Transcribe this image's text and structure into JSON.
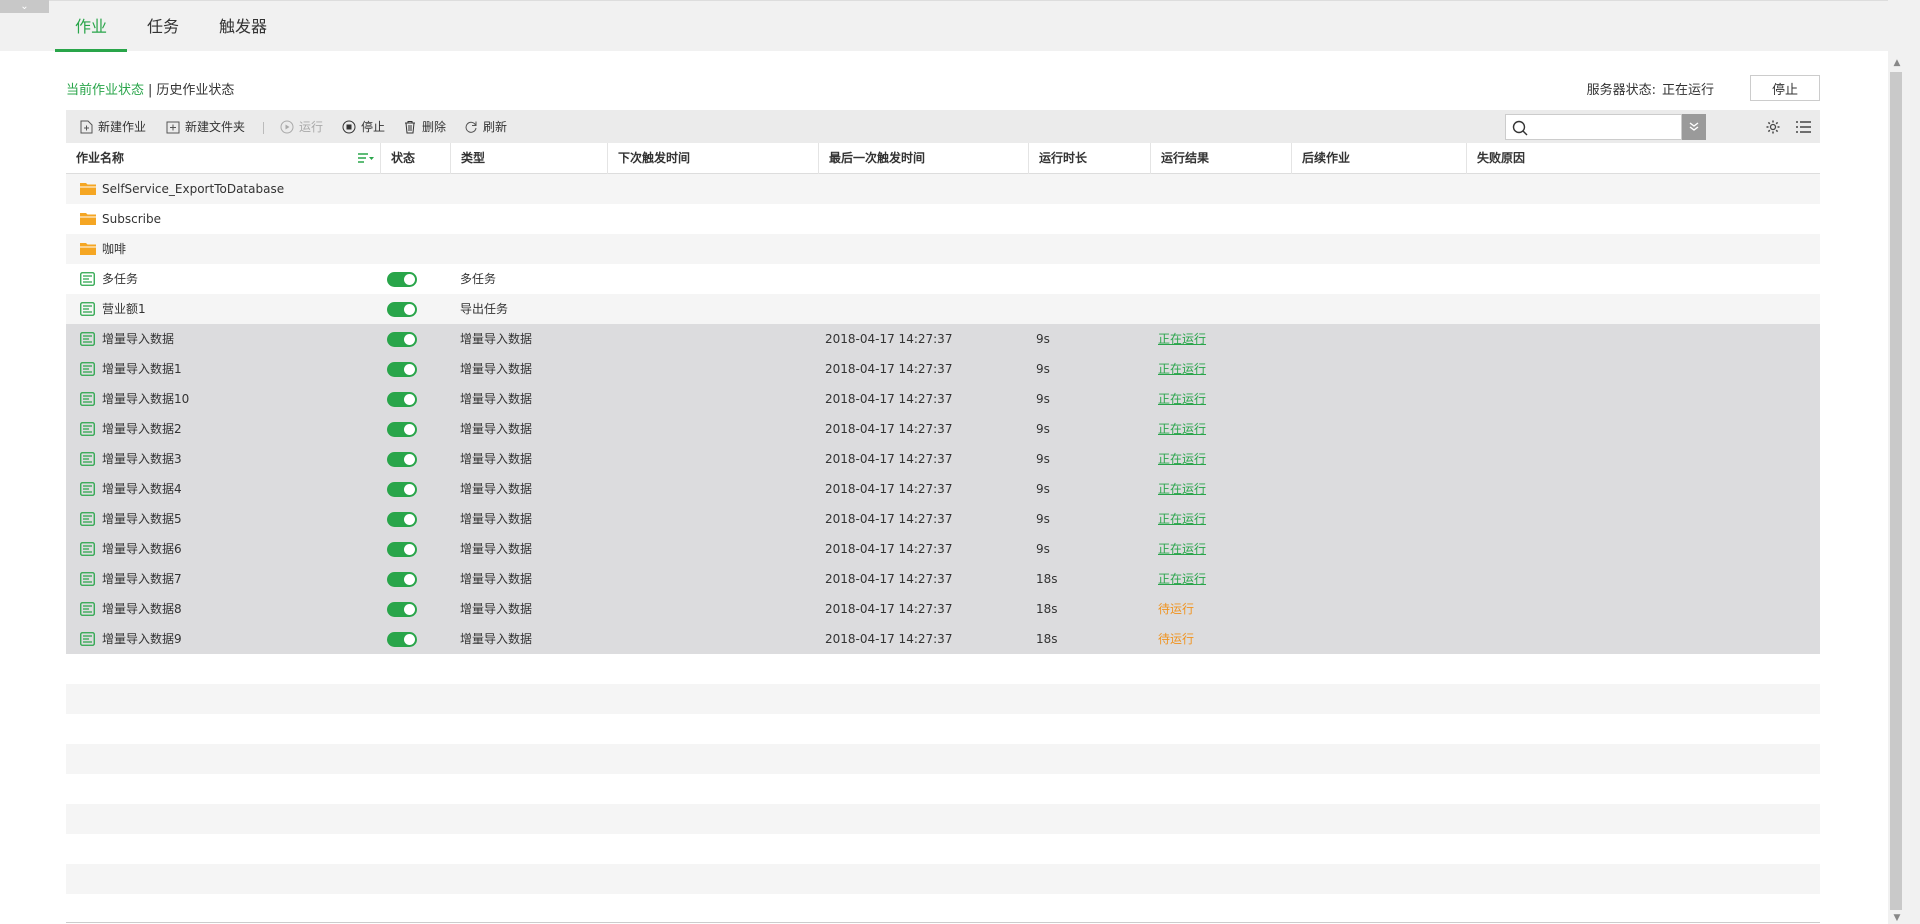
{
  "collapse_glyph": "⌄",
  "tabs": [
    {
      "label": "作业",
      "active": true
    },
    {
      "label": "任务",
      "active": false
    },
    {
      "label": "触发器",
      "active": false
    }
  ],
  "status_tabs": {
    "current": "当前作业状态",
    "separator": "|",
    "history": "历史作业状态"
  },
  "server_status": {
    "label": "服务器状态:",
    "value": "正在运行",
    "stop_button": "停止"
  },
  "toolbar": {
    "new_job": "新建作业",
    "new_folder": "新建文件夹",
    "run": "运行",
    "stop": "停止",
    "delete": "删除",
    "refresh": "刷新",
    "search_placeholder": ""
  },
  "columns": [
    "作业名称",
    "状态",
    "类型",
    "下次触发时间",
    "最后一次触发时间",
    "运行时长",
    "运行结果",
    "后续作业",
    "失败原因"
  ],
  "rows": [
    {
      "kind": "folder",
      "name": "SelfService_ExportToDatabase",
      "toggle": false,
      "type": "",
      "last": "",
      "duration": "",
      "result": "",
      "result_kind": "",
      "selected": false
    },
    {
      "kind": "folder",
      "name": "Subscribe",
      "toggle": false,
      "type": "",
      "last": "",
      "duration": "",
      "result": "",
      "result_kind": "",
      "selected": false
    },
    {
      "kind": "folder",
      "name": "咖啡",
      "toggle": false,
      "type": "",
      "last": "",
      "duration": "",
      "result": "",
      "result_kind": "",
      "selected": false
    },
    {
      "kind": "job",
      "name": "多任务",
      "toggle": true,
      "type": "多任务",
      "last": "",
      "duration": "",
      "result": "",
      "result_kind": "",
      "selected": false
    },
    {
      "kind": "job",
      "name": "营业额1",
      "toggle": true,
      "type": "导出任务",
      "last": "",
      "duration": "",
      "result": "",
      "result_kind": "",
      "selected": false
    },
    {
      "kind": "job",
      "name": "增量导入数据",
      "toggle": true,
      "type": "增量导入数据",
      "last": "2018-04-17 14:27:37",
      "duration": "9s",
      "result": "正在运行",
      "result_kind": "running",
      "selected": true
    },
    {
      "kind": "job",
      "name": "增量导入数据1",
      "toggle": true,
      "type": "增量导入数据",
      "last": "2018-04-17 14:27:37",
      "duration": "9s",
      "result": "正在运行",
      "result_kind": "running",
      "selected": true
    },
    {
      "kind": "job",
      "name": "增量导入数据10",
      "toggle": true,
      "type": "增量导入数据",
      "last": "2018-04-17 14:27:37",
      "duration": "9s",
      "result": "正在运行",
      "result_kind": "running",
      "selected": true
    },
    {
      "kind": "job",
      "name": "增量导入数据2",
      "toggle": true,
      "type": "增量导入数据",
      "last": "2018-04-17 14:27:37",
      "duration": "9s",
      "result": "正在运行",
      "result_kind": "running",
      "selected": true
    },
    {
      "kind": "job",
      "name": "增量导入数据3",
      "toggle": true,
      "type": "增量导入数据",
      "last": "2018-04-17 14:27:37",
      "duration": "9s",
      "result": "正在运行",
      "result_kind": "running",
      "selected": true
    },
    {
      "kind": "job",
      "name": "增量导入数据4",
      "toggle": true,
      "type": "增量导入数据",
      "last": "2018-04-17 14:27:37",
      "duration": "9s",
      "result": "正在运行",
      "result_kind": "running",
      "selected": true
    },
    {
      "kind": "job",
      "name": "增量导入数据5",
      "toggle": true,
      "type": "增量导入数据",
      "last": "2018-04-17 14:27:37",
      "duration": "9s",
      "result": "正在运行",
      "result_kind": "running",
      "selected": true
    },
    {
      "kind": "job",
      "name": "增量导入数据6",
      "toggle": true,
      "type": "增量导入数据",
      "last": "2018-04-17 14:27:37",
      "duration": "9s",
      "result": "正在运行",
      "result_kind": "running",
      "selected": true
    },
    {
      "kind": "job",
      "name": "增量导入数据7",
      "toggle": true,
      "type": "增量导入数据",
      "last": "2018-04-17 14:27:37",
      "duration": "18s",
      "result": "正在运行",
      "result_kind": "running",
      "selected": true
    },
    {
      "kind": "job",
      "name": "增量导入数据8",
      "toggle": true,
      "type": "增量导入数据",
      "last": "2018-04-17 14:27:37",
      "duration": "18s",
      "result": "待运行",
      "result_kind": "waiting",
      "selected": true
    },
    {
      "kind": "job",
      "name": "增量导入数据9",
      "toggle": true,
      "type": "增量导入数据",
      "last": "2018-04-17 14:27:37",
      "duration": "18s",
      "result": "待运行",
      "result_kind": "waiting",
      "selected": true
    }
  ],
  "colors": {
    "accent": "#29a54a",
    "waiting": "#f0931f",
    "folder": "#f5a623",
    "selected_row": "#dcdcde"
  }
}
